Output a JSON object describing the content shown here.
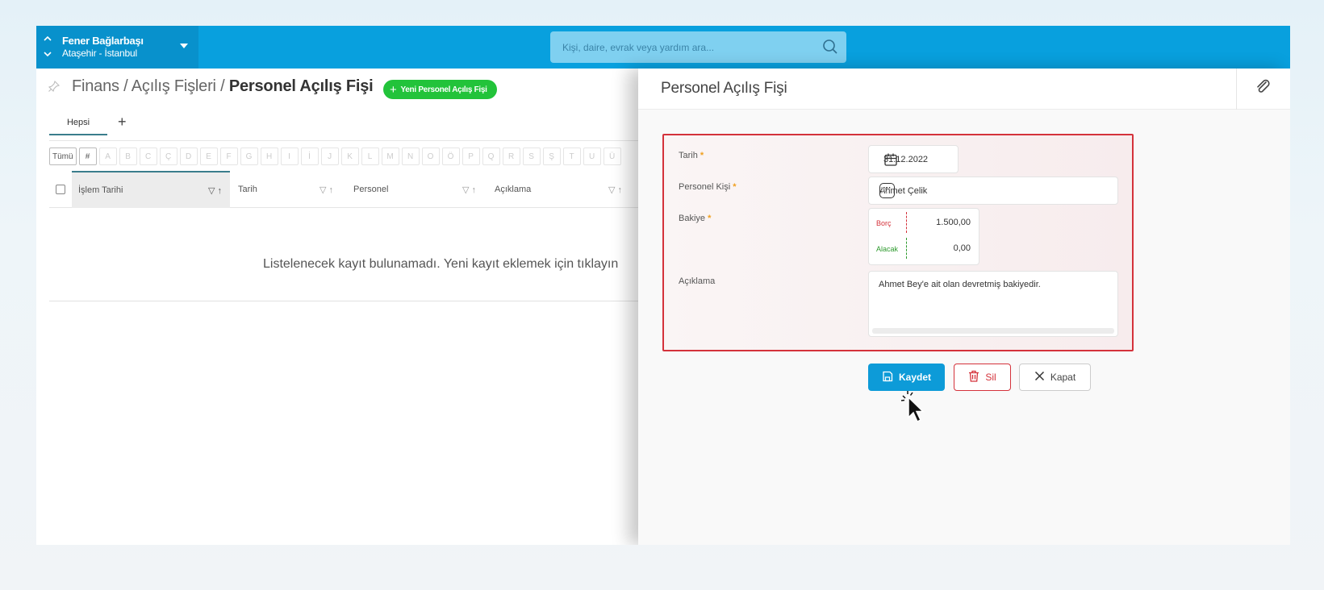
{
  "topbar": {
    "org_name": "Fener Bağlarbaşı",
    "org_location": "Ataşehir - İstanbul",
    "search_placeholder": "Kişi, daire, evrak veya yardım ara...",
    "accent": "#08a0de"
  },
  "page": {
    "breadcrumb_prefix": "Finans / Açılış Fişleri /",
    "breadcrumb_current": "Personel Açılış Fişi",
    "new_button": "Yeni Personel Açılış Fişi",
    "tabs": [
      {
        "label": "Hepsi"
      }
    ],
    "add_tab": "+",
    "alpha_filter": [
      "Tümü",
      "#",
      "A",
      "B",
      "C",
      "Ç",
      "D",
      "E",
      "F",
      "G",
      "H",
      "I",
      "İ",
      "J",
      "K",
      "L",
      "M",
      "N",
      "O",
      "Ö",
      "P",
      "Q",
      "R",
      "S",
      "Ş",
      "T",
      "U",
      "Ü"
    ],
    "columns": [
      "İşlem Tarihi",
      "Tarih",
      "Personel",
      "Açıklama"
    ],
    "empty_message": "Listelenecek kayıt bulunamadı. Yeni kayıt eklemek için tıklayın"
  },
  "panel": {
    "title": "Personel Açılış Fişi",
    "fields": {
      "date_label": "Tarih",
      "date_value": "31.12.2022",
      "person_label": "Personel Kişi",
      "person_value": "Ahmet Çelik",
      "balance_label": "Bakiye",
      "debit_label": "Borç",
      "debit_value": "1.500,00",
      "credit_label": "Alacak",
      "credit_value": "0,00",
      "desc_label": "Açıklama",
      "desc_value": "Ahmet Bey'e ait olan devretmiş bakiyedir."
    },
    "required_mark": "*",
    "buttons": {
      "save": "Kaydet",
      "delete": "Sil",
      "close": "Kapat"
    },
    "colors": {
      "error": "#d4323b",
      "debit": "#d4323b",
      "credit": "#2e9a2e",
      "save": "#0d9bd8"
    }
  }
}
